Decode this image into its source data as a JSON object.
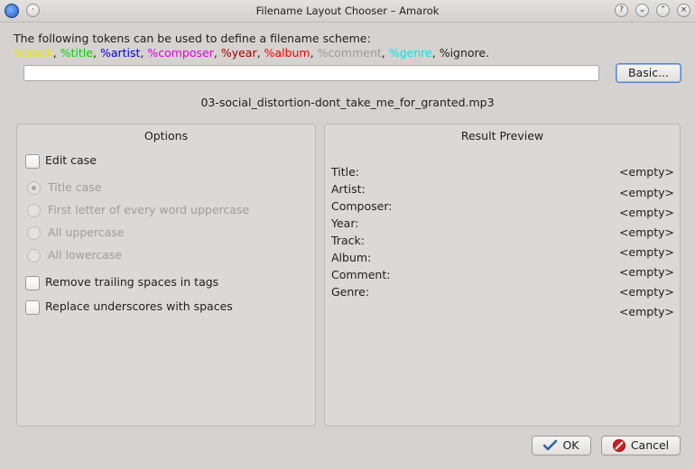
{
  "window": {
    "title": "Filename Layout Chooser – Amarok",
    "help_btn": "?",
    "minimize_btn": "⌄",
    "maximize_btn": "⌃",
    "close_btn": "×"
  },
  "intro": "The following tokens can be used to define a filename scheme:",
  "tokens": [
    {
      "text": "%track",
      "color": "#e8e800"
    },
    {
      "text": "%title",
      "color": "#00d400"
    },
    {
      "text": "%artist",
      "color": "#0000dd"
    },
    {
      "text": "%composer",
      "color": "#e000e0"
    },
    {
      "text": "%year",
      "color": "#a00000"
    },
    {
      "text": "%album",
      "color": "#ee0000"
    },
    {
      "text": "%comment",
      "color": "#9a9a9a"
    },
    {
      "text": "%genre",
      "color": "#00e8e8"
    },
    {
      "text": "%ignore",
      "color": "#1e1e1e"
    }
  ],
  "scheme_input": {
    "value": "",
    "placeholder": ""
  },
  "basic_button": "Basic...",
  "filename": "03-social_distortion-dont_take_me_for_granted.mp3",
  "options": {
    "title": "Options",
    "edit_case": "Edit case",
    "title_case": "Title case",
    "first_letter": "First letter of every word uppercase",
    "all_uppercase": "All uppercase",
    "all_lowercase": "All lowercase",
    "remove_trailing": "Remove trailing spaces in tags",
    "replace_underscores": "Replace underscores with spaces"
  },
  "preview": {
    "title": "Result Preview",
    "labels": [
      "Title:",
      "Artist:",
      "Composer:",
      "Year:",
      "Track:",
      "Album:",
      "Comment:",
      "Genre:"
    ],
    "values": [
      "<empty>",
      "<empty>",
      "<empty>",
      "<empty>",
      "<empty>",
      "<empty>",
      "<empty>",
      "<empty>"
    ]
  },
  "ok_button": "OK",
  "cancel_button": "Cancel"
}
